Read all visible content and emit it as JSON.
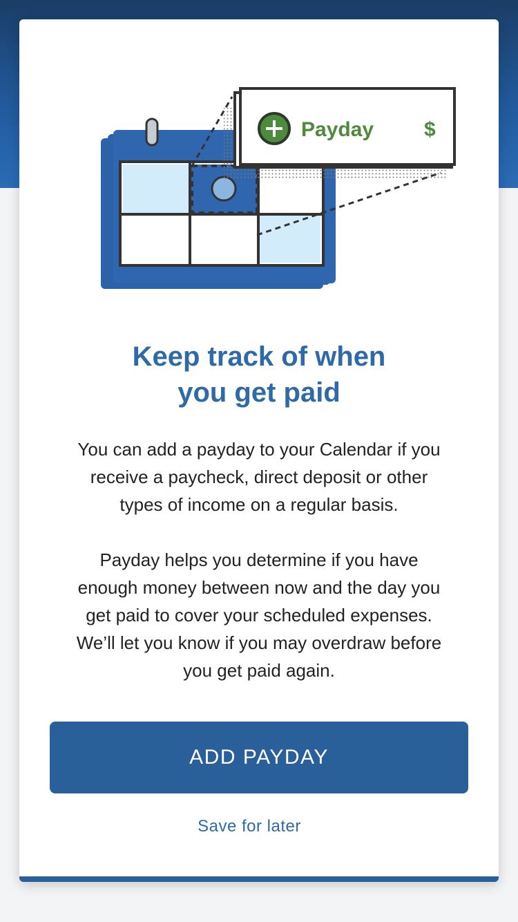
{
  "illustration": {
    "badge_label": "Payday",
    "badge_currency": "$",
    "badge_icon": "plus-circle-icon",
    "calendar_icon": "calendar-icon"
  },
  "onboarding": {
    "title_line1": "Keep track of when",
    "title_line2": "you get paid",
    "para1_line1": "You can add a payday to your Calendar if you",
    "para1_line2": "receive a paycheck, direct deposit or other",
    "para1_line3": "types of income on a regular basis.",
    "para2_line1": "Payday helps you determine if you have",
    "para2_line2": "enough money between now and the day you",
    "para2_line3": "get paid to cover your scheduled expenses.",
    "para2_line4": "We’ll let you know if you may overdraw before",
    "para2_line5": "you get paid again."
  },
  "actions": {
    "add_label": "ADD PAYDAY",
    "later_label": "Save for later"
  },
  "colors": {
    "primary": "#2a6099",
    "title": "#2f6aa8",
    "accent_green": "#4e8a3c",
    "cell_light_blue": "#d3ecfb"
  }
}
